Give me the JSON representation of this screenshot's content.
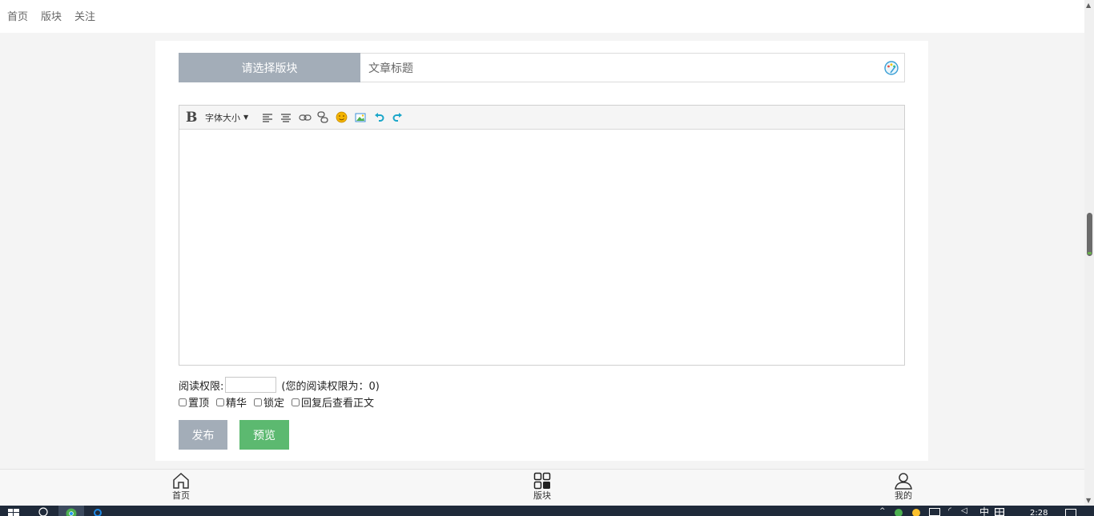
{
  "topnav": {
    "items": [
      "首页",
      "版块",
      "关注"
    ]
  },
  "post": {
    "select_board_label": "请选择版块",
    "title_placeholder": "文章标题"
  },
  "editor": {
    "toolbar": {
      "font_size_label": "字体大小",
      "caret": "▼"
    }
  },
  "permissions": {
    "label": "阅读权限:",
    "input_value": "",
    "hint": "(您的阅读权限为：0)"
  },
  "options": [
    "置顶",
    "精华",
    "锁定",
    "回复后查看正文"
  ],
  "buttons": {
    "publish": "发布",
    "preview": "预览"
  },
  "bottomnav": {
    "items": [
      "首页",
      "版块",
      "我的"
    ]
  },
  "taskbar": {
    "ime": "中",
    "time": "2:28"
  },
  "colors": {
    "select_board_bg": "#a3adb8",
    "publish_bg": "#a3adb8",
    "preview_bg": "#5cb970",
    "emoji": "#f4b400",
    "undo_redo": "#1aa6c9",
    "taskbar": "#1f2a3a"
  },
  "icons": {
    "toolbar": [
      "bold-icon",
      "align-left-icon",
      "align-center-icon",
      "link-icon",
      "unlink-icon",
      "emoji-icon",
      "image-icon",
      "undo-icon",
      "redo-icon"
    ],
    "title": "palette-icon",
    "bottomnav": [
      "home-icon",
      "grid-icon",
      "user-icon"
    ]
  }
}
